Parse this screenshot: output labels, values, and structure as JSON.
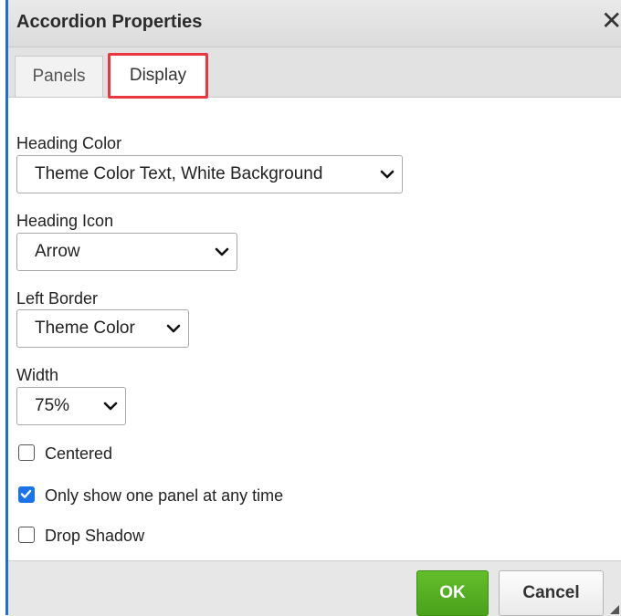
{
  "dialog": {
    "title": "Accordion Properties",
    "close_symbol": "✕"
  },
  "tabs": [
    {
      "label": "Panels",
      "selected": false
    },
    {
      "label": "Display",
      "selected": true
    }
  ],
  "fields": {
    "heading_color": {
      "label": "Heading Color",
      "value": "Theme Color Text, White Background"
    },
    "heading_icon": {
      "label": "Heading Icon",
      "value": "Arrow"
    },
    "left_border": {
      "label": "Left Border",
      "value": "Theme Color"
    },
    "width": {
      "label": "Width",
      "value": "75%"
    }
  },
  "checkboxes": [
    {
      "label": "Centered",
      "checked": false
    },
    {
      "label": "Only show one panel at any time",
      "checked": true
    },
    {
      "label": "Drop Shadow",
      "checked": false
    }
  ],
  "buttons": {
    "ok": "OK",
    "cancel": "Cancel"
  },
  "colors": {
    "ok_green": "#52ad1f",
    "active_tab_outline": "#e8373f",
    "checkbox_blue": "#1a73e8",
    "page_edge_blue": "#1e6fcf"
  },
  "icons": {
    "close": "close-icon",
    "select_arrow": "chevron-down-icon",
    "check": "check-icon",
    "resize": "resize-grip-icon"
  }
}
